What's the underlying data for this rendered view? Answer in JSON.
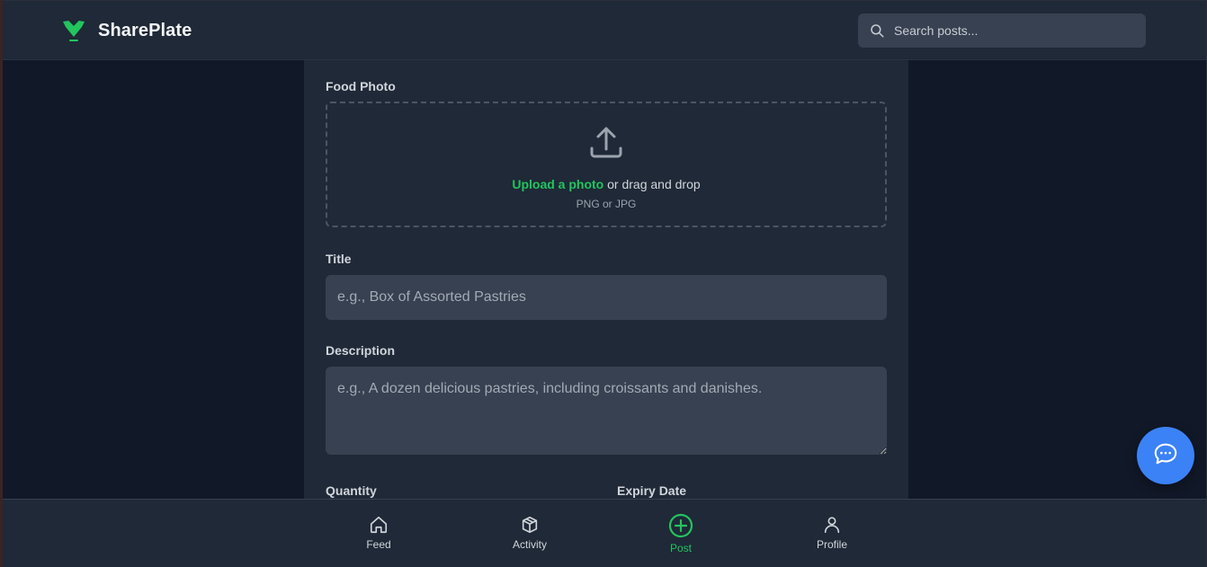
{
  "header": {
    "app_name": "SharePlate",
    "search_placeholder": "Search posts..."
  },
  "form": {
    "photo_label": "Food Photo",
    "upload_link": "Upload a photo",
    "upload_text": " or drag and drop",
    "upload_hint": "PNG or JPG",
    "title_label": "Title",
    "title_placeholder": "e.g., Box of Assorted Pastries",
    "description_label": "Description",
    "description_placeholder": "e.g., A dozen delicious pastries, including croissants and danishes.",
    "quantity_label": "Quantity",
    "expiry_label": "Expiry Date"
  },
  "nav": {
    "items": [
      {
        "label": "Feed",
        "icon": "home-icon"
      },
      {
        "label": "Activity",
        "icon": "box-icon"
      },
      {
        "label": "Post",
        "icon": "plus-circle-icon"
      },
      {
        "label": "Profile",
        "icon": "user-icon"
      }
    ],
    "active": "Post"
  },
  "colors": {
    "accent": "#22c55e",
    "fab": "#3b82f6",
    "surface": "#1f2937",
    "background": "#111827",
    "input": "#374151"
  }
}
